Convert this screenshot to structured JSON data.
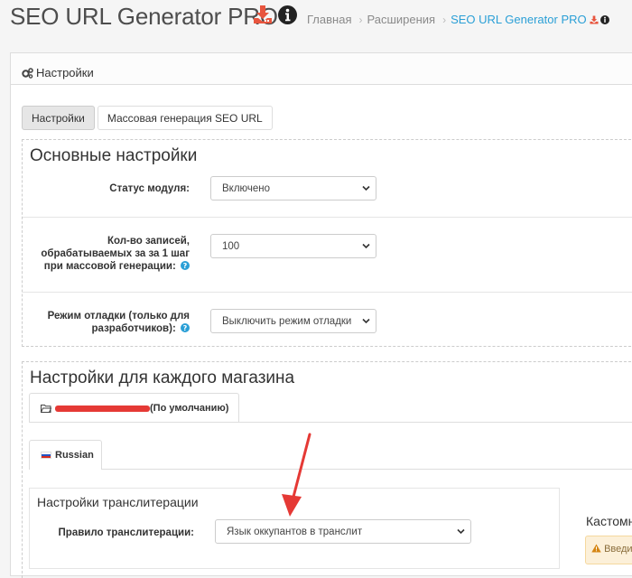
{
  "header": {
    "title": "SEO URL Generator PRO",
    "breadcrumb": [
      "Главная",
      "Расширения",
      "SEO URL Generator PRO"
    ]
  },
  "panel": {
    "heading": "Настройки",
    "tabs": [
      {
        "label": "Настройки",
        "active": true
      },
      {
        "label": "Массовая генерация SEO URL",
        "active": false
      }
    ]
  },
  "basic": {
    "legend": "Основные настройки",
    "fields": [
      {
        "label": "Статус модуля:",
        "value": "Включено"
      },
      {
        "label": "Кол-во записей, обрабатываемых за за 1 шаг при массовой генерации:",
        "value": "100"
      },
      {
        "label": "Режим отладки (только для разработчиков):",
        "value": "Выключить режим отладки"
      }
    ]
  },
  "stores": {
    "legend": "Настройки для каждого магазина",
    "store_tab_suffix": "(По умолчанию)",
    "language_tab": "Russian"
  },
  "translit": {
    "title": "Настройки транслитерации",
    "rule_label": "Правило транслитерации:",
    "rule_value": "Язык оккупантов в транслит"
  },
  "right_column": {
    "heading": "Кастомн",
    "warning": "Введи"
  },
  "colors": {
    "accent": "#2a9fd6",
    "download_icon": "#e8553e",
    "annotation_arrow": "#e53935",
    "warning_bg": "#fcf0d9"
  },
  "icons": [
    "download-icon",
    "info-icon",
    "gears-icon",
    "help-icon",
    "folder-icon",
    "flag-ru-icon",
    "warning-icon",
    "chevron-down-icon"
  ]
}
